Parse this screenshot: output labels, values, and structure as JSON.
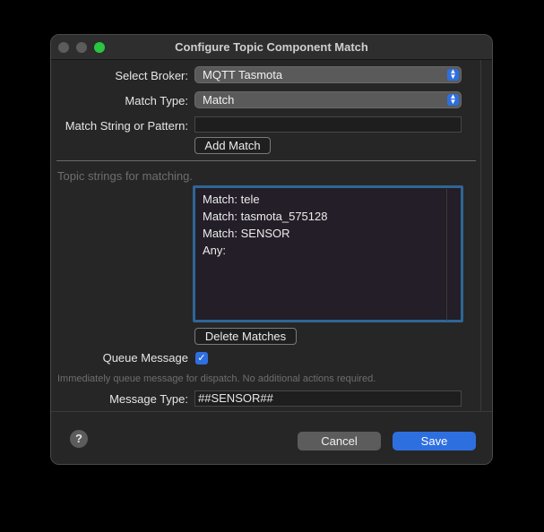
{
  "window": {
    "title": "Configure Topic Component Match"
  },
  "form": {
    "broker_label": "Select Broker:",
    "broker_value": "MQTT Tasmota",
    "match_type_label": "Match Type:",
    "match_type_value": "Match",
    "pattern_label": "Match String or Pattern:",
    "pattern_value": "",
    "add_match_label": "Add Match",
    "topic_hint": "Topic strings for matching.",
    "matches": [
      "Match: tele",
      "Match: tasmota_575128",
      "Match: SENSOR",
      "Any:"
    ],
    "delete_matches_label": "Delete Matches",
    "queue_label": "Queue Message",
    "queue_checked": true,
    "queue_hint": "Immediately queue message for dispatch.  No additional actions required.",
    "message_type_label": "Message Type:",
    "message_type_value": "##SENSOR##"
  },
  "footer": {
    "help_label": "?",
    "cancel_label": "Cancel",
    "save_label": "Save"
  },
  "colors": {
    "accent": "#2e6fe0",
    "list_focus": "#2f6696"
  }
}
